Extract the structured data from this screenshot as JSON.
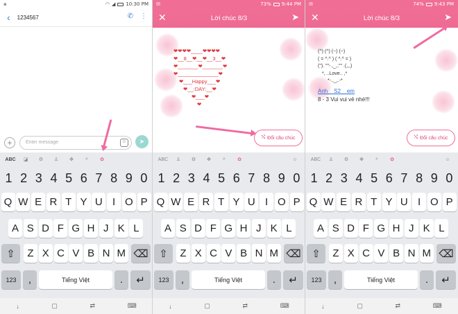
{
  "panel1": {
    "status_time": "10:30 PM",
    "status_pct": "",
    "contact": "1234567",
    "input_placeholder": "Enter message"
  },
  "panel2": {
    "status_time": "9:44 PM",
    "status_pct": "73%",
    "title": "Lời chúc 8/3",
    "button": "Đổi câu chúc",
    "card": [
      "❤❤❤❤____❤❤❤❤",
      "❤__8__❤__❤__3__❤",
      "❤_______❤_______❤",
      "❤______________❤",
      "❤___Happy___❤",
      "❤__:DAY:__❤",
      "❤___❤",
      "❤"
    ]
  },
  "panel3": {
    "status_time": "9:43 PM",
    "status_pct": "74%",
    "title": "Lời chúc 8/3",
    "button": "Đổi câu chúc",
    "card": [
      "(^) (^) (~) (~)",
      "( = ^.^ ) ( ^.^ = )",
      "(\"). \"\"-.,_,.\"\" .(,,,)",
      "*, ..Love.. ,*",
      "*-.,_,.-*"
    ],
    "names": "Anh__S2__em",
    "wish": "8 - 3 Vui vui vẻ nhé!!!"
  },
  "keyboard": {
    "numbers": [
      "1",
      "2",
      "3",
      "4",
      "5",
      "6",
      "7",
      "8",
      "9",
      "0"
    ],
    "row1": [
      "Q",
      "W",
      "E",
      "R",
      "T",
      "Y",
      "U",
      "I",
      "O",
      "P"
    ],
    "row2": [
      "A",
      "S",
      "D",
      "F",
      "G",
      "H",
      "J",
      "K",
      "L"
    ],
    "row3": [
      "Z",
      "X",
      "C",
      "V",
      "B",
      "N",
      "M"
    ],
    "mode": "123",
    "space": "Tiếng Việt",
    "abc": "ABC"
  }
}
